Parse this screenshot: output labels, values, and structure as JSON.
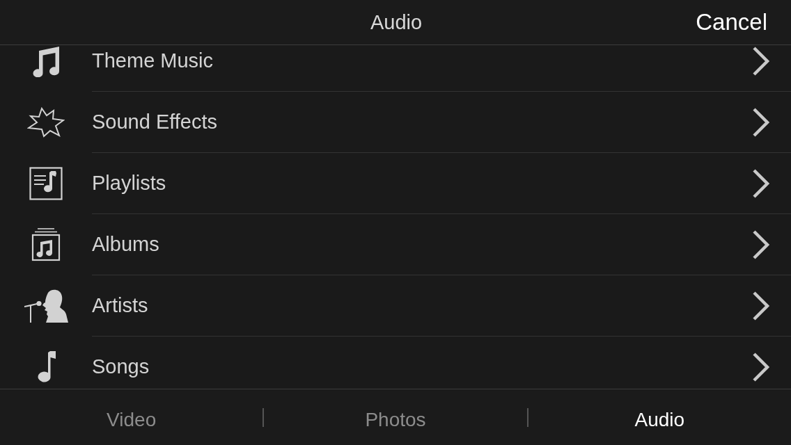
{
  "header": {
    "title": "Audio",
    "cancel_button": "Cancel"
  },
  "list_items": [
    {
      "label": "Theme Music",
      "kind": "notes"
    },
    {
      "label": "Sound Effects",
      "kind": "burst"
    },
    {
      "label": "Playlists",
      "kind": "playlist"
    },
    {
      "label": "Albums",
      "kind": "album"
    },
    {
      "label": "Artists",
      "kind": "singer"
    },
    {
      "label": "Songs",
      "kind": "note"
    }
  ],
  "tabs": [
    {
      "label": "Video",
      "selected": false
    },
    {
      "label": "Photos",
      "selected": false
    },
    {
      "label": "Audio",
      "selected": true
    }
  ]
}
